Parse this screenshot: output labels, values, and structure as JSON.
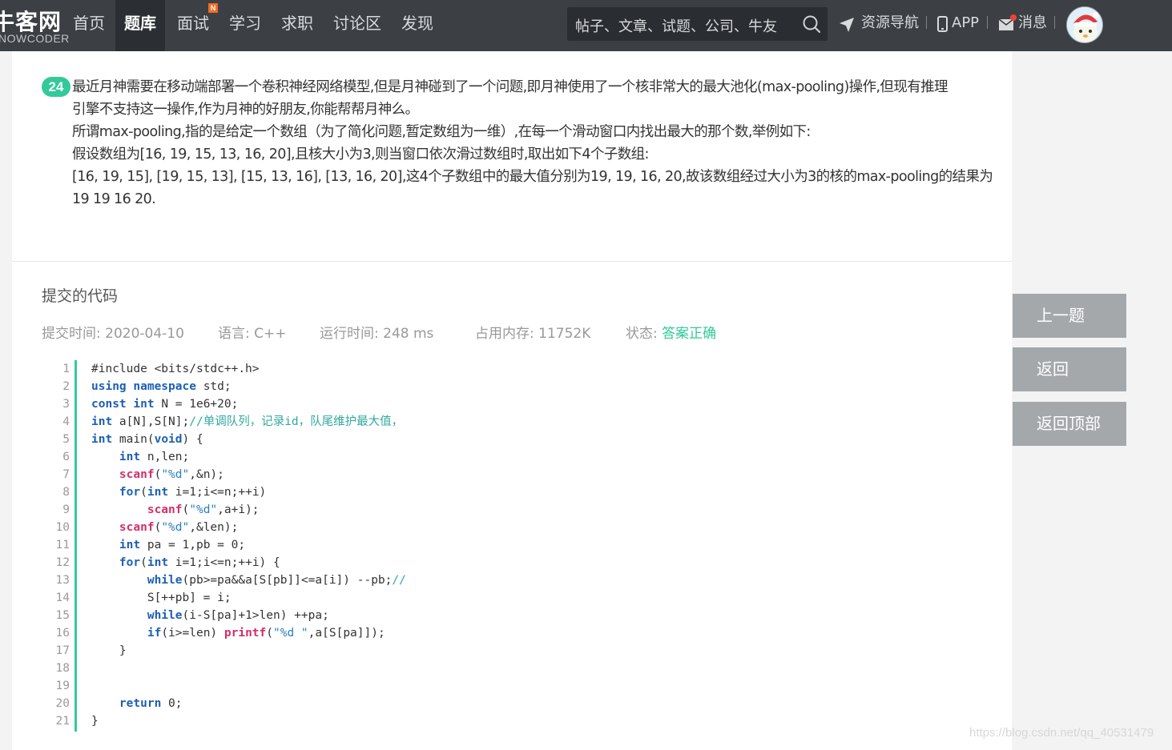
{
  "nav": {
    "logo_main": "牛客网",
    "logo_sub": "NOWCODER",
    "items": [
      {
        "label": "首页"
      },
      {
        "label": "题库"
      },
      {
        "label": "面试",
        "badge": "N"
      },
      {
        "label": "学习"
      },
      {
        "label": "求职"
      },
      {
        "label": "讨论区"
      },
      {
        "label": "发现"
      }
    ],
    "search_placeholder": "帖子、文章、试题、公司、牛友",
    "links": {
      "resource": "资源导航",
      "app": "APP",
      "message": "消息"
    }
  },
  "question": {
    "number": "24",
    "paragraphs": [
      "最近月神需要在移动端部署一个卷积神经网络模型,但是月神碰到了一个问题,即月神使用了一个核非常大的最大池化(max-pooling)操作,但现有推理",
      "引擎不支持这一操作,作为月神的好朋友,你能帮帮月神么。",
      "所谓max-pooling,指的是给定一个数组（为了简化问题,暂定数组为一维）,在每一个滑动窗口内找出最大的那个数,举例如下:",
      "假设数组为[16, 19, 15, 13, 16, 20],且核大小为3,则当窗口依次滑过数组时,取出如下4个子数组:",
      "[16, 19, 15], [19, 15, 13], [15, 13, 16], [13, 16, 20],这4个子数组中的最大值分别为19, 19, 16, 20,故该数组经过大小为3的核的max-pooling的结果为",
      "19 19 16 20."
    ]
  },
  "submission": {
    "title": "提交的代码",
    "time_label": "提交时间:",
    "time": "2020-04-10",
    "lang_label": "语言:",
    "lang": "C++",
    "runtime_label": "运行时间:",
    "runtime": "248 ms",
    "memory_label": "占用内存:",
    "memory": "11752K",
    "status_label": "状态:",
    "status": "答案正确"
  },
  "code": [
    "#include <bits/stdc++.h>",
    "using namespace std;",
    "const int N = 1e6+20;",
    "int a[N],S[N];//单调队列，记录id，队尾维护最大值，",
    "int main(void) {",
    "    int n,len;",
    "    scanf(\"%d\",&n);",
    "    for(int i=1;i<=n;++i)",
    "        scanf(\"%d\",a+i);",
    "    scanf(\"%d\",&len);",
    "    int pa = 1,pb = 0;",
    "    for(int i=1;i<=n;++i) {",
    "        while(pb>=pa&&a[S[pb]]<=a[i]) --pb;//",
    "        S[++pb] = i;",
    "        while(i-S[pa]+1>len) ++pa;",
    "        if(i>=len) printf(\"%d \",a[S[pa]]);",
    "    }",
    "",
    "",
    "    return 0;",
    "}"
  ],
  "side_buttons": {
    "prev": "上一题",
    "back": "返回",
    "top": "返回顶部"
  },
  "watermark": "https://blog.csdn.net/qq_40531479",
  "colors": {
    "nav_bg": "#3c4045",
    "accent_green": "#32ca99",
    "side_button": "#a5a8ab"
  }
}
